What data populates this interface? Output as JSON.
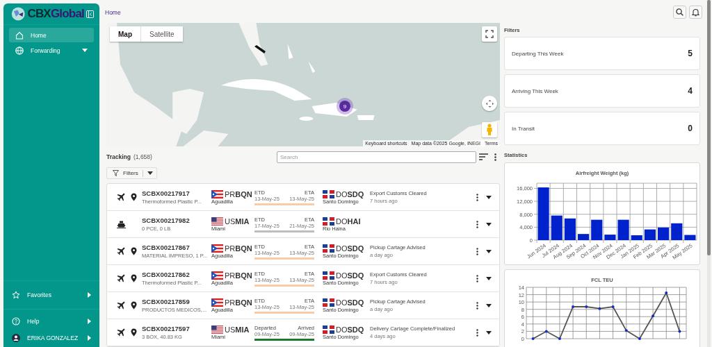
{
  "sidebar": {
    "logo": {
      "prefix": "CBX",
      "name": "Global"
    },
    "nav": [
      {
        "label": "Home",
        "selected": true,
        "has_children": false
      },
      {
        "label": "Forwarding",
        "selected": false,
        "has_children": true
      }
    ],
    "bottom": [
      {
        "label": "Favorites"
      },
      {
        "label": "Help"
      },
      {
        "label": "ERIKA GONZALEZ"
      }
    ]
  },
  "breadcrumb": "Home",
  "map": {
    "kind": "picture",
    "tabs": [
      {
        "label": "Map",
        "selected": true
      },
      {
        "label": "Satellite",
        "selected": false
      }
    ],
    "cluster": "9",
    "footer": [
      "Keyboard shortcuts",
      "Map data ©2025 Google, INEGI",
      "Terms"
    ]
  },
  "tracking": {
    "title": "Tracking",
    "count": "(1,658)",
    "search": {
      "placeholder": "Search"
    },
    "filters": "Filters",
    "rows": [
      {
        "kind": "air",
        "pin": true,
        "id": "SCBX00217917",
        "desc": "Thermoformed Plastic P...",
        "origin": {
          "kind": "pr",
          "code": "PR**BQN**",
          "city": "Aguadilla"
        },
        "dep_label": "ETD",
        "dep_date": "13-May-25",
        "arr_label": "ETA",
        "arr_date": "13-May-25",
        "color": "#f9cba7",
        "dest": {
          "kind": "do",
          "code": "DO**SDQ**",
          "city": "Santo Domingo"
        },
        "status": "Export Customs Cleared",
        "time": "7 hours ago"
      },
      {
        "kind": "ocean",
        "pin": false,
        "id": "SCBX00217982",
        "desc": "0 PCE, 0 LB",
        "origin": {
          "kind": "us",
          "code": "US**MIA**",
          "city": "Miami"
        },
        "dep_label": "ETD",
        "dep_date": "17-May-25",
        "arr_label": "ETA",
        "arr_date": "21-May-25",
        "color": "#bdbdbd",
        "dest": {
          "kind": "do",
          "code": "DO**HAI**",
          "city": "Rio Haina"
        }
      },
      {
        "kind": "air",
        "pin": true,
        "id": "SCBX00217867",
        "desc": "MATERIAL IMPRESO, 1 P...",
        "origin": {
          "kind": "pr",
          "code": "PR**BQN**",
          "city": "Aguadilla"
        },
        "dep_label": "ETD",
        "dep_date": "13-May-25",
        "arr_label": "ETA",
        "arr_date": "13-May-25",
        "color": "#f9cba7",
        "dest": {
          "kind": "do",
          "code": "DO**SDQ**",
          "city": "Santo Domingo"
        },
        "status": "Pickup Cartage Advised",
        "time": "a day ago"
      },
      {
        "kind": "air",
        "pin": true,
        "id": "SCBX00217862",
        "desc": "Thermoformed Plastic P...",
        "origin": {
          "kind": "pr",
          "code": "PR**BQN**",
          "city": "Aguadilla"
        },
        "dep_label": "ETD",
        "dep_date": "13-May-25",
        "arr_label": "ETA",
        "arr_date": "13-May-25",
        "color": "#f9cba7",
        "dest": {
          "kind": "do",
          "code": "DO**SDQ**",
          "city": "Santo Domingo"
        },
        "status": "Export Customs Cleared",
        "time": "7 hours ago"
      },
      {
        "kind": "air",
        "pin": true,
        "id": "SCBX00217859",
        "desc": "PRODUCTOS MEDICOS,...",
        "origin": {
          "kind": "pr",
          "code": "PR**BQN**",
          "city": "Aguadilla"
        },
        "dep_label": "ETD",
        "dep_date": "13-May-25",
        "arr_label": "ETA",
        "arr_date": "13-May-25",
        "color": "#f9cba7",
        "dest": {
          "kind": "do",
          "code": "DO**SDQ**",
          "city": "Santo Domingo"
        },
        "status": "Pickup Cartage Advised",
        "time": "a day ago"
      },
      {
        "kind": "air",
        "pin": true,
        "id": "SCBX00217597",
        "desc": "3 BOX, 40.83 KG",
        "origin": {
          "kind": "us",
          "code": "US**MIA**",
          "city": "Miami"
        },
        "dep_label": "Departed",
        "dep_date": "09-May-25",
        "arr_label": "Arrived",
        "arr_date": "09-May-25",
        "color": "#1b7a2a",
        "dest": {
          "kind": "do",
          "code": "DO**SDQ**",
          "city": "Santo Domingo"
        },
        "status": "Delivery Cartage Complete/Finalized",
        "time": "4 days ago"
      }
    ]
  },
  "filters": {
    "title": "Filters",
    "cards": [
      {
        "label": "Departing This Week",
        "value": "5"
      },
      {
        "label": "Arriving This Week",
        "value": "4"
      },
      {
        "label": "In Transit",
        "value": "0"
      }
    ]
  },
  "statistics": {
    "title": "Statistics",
    "charts": [
      {
        "chart_data": {
          "type": "bar",
          "title": "Airfreight Weight (kg)",
          "categories": [
            "Jun 2024",
            "Jul 2024",
            "Aug 2024",
            "Sep 2024",
            "Oct 2024",
            "Nov 2024",
            "Dec 2024",
            "Jan 2025",
            "Feb 2025",
            "Mar 2025",
            "Apr 2025",
            "May 2025"
          ],
          "series": [
            {
              "color": "#0022cc",
              "values": [
                16300,
                7600,
                6700,
                1900,
                6300,
                1700,
                6300,
                1500,
                3300,
                3900,
                5200,
                1600
              ]
            }
          ],
          "ylim": [
            0,
            17600
          ],
          "grid": true,
          "yticks": [
            {
              "value": 0,
              "label": "0"
            },
            {
              "value": 4000,
              "label": "4,000"
            },
            {
              "value": 8000,
              "label": "8,000"
            },
            {
              "value": 12000,
              "label": "12,000"
            },
            {
              "value": 16000,
              "label": "16,000"
            }
          ]
        }
      },
      {
        "chart_data": {
          "type": "line",
          "title": "FCL TEU",
          "series": [
            {
              "color": "#555555",
              "values": [
                0,
                2,
                0,
                8.7,
                8.7,
                8.2,
                8.7,
                2.2,
                0,
                6.2,
                12.5,
                2
              ]
            }
          ],
          "ylim": [
            0,
            14
          ],
          "grid": true,
          "yticks": [
            0,
            2,
            4,
            6,
            8,
            10,
            12,
            14
          ]
        }
      }
    ]
  }
}
